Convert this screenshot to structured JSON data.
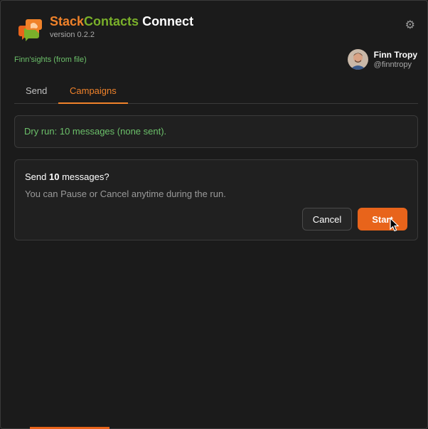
{
  "app": {
    "title_part1": "Stack",
    "title_part2": "Contacts",
    "title_part3": " Connect",
    "version": "version 0.2.2"
  },
  "source_label": "Finn'sights (from file)",
  "user": {
    "name": "Finn Tropy",
    "handle": "@finntropy"
  },
  "tabs": [
    {
      "label": "Send",
      "active": false
    },
    {
      "label": "Campaigns",
      "active": true
    }
  ],
  "dry_run": {
    "text": "Dry run: 10 messages (none sent)."
  },
  "confirm": {
    "title_prefix": "Send ",
    "count": "10",
    "title_suffix": " messages?",
    "subtitle": "You can Pause or Cancel anytime during the run.",
    "cancel_label": "Cancel",
    "start_label": "Start"
  },
  "colors": {
    "accent_orange": "#f0822a",
    "accent_green": "#7ab02a",
    "success_text": "#6cc06a",
    "primary_button": "#e8641b"
  },
  "icons": {
    "logo": "chat-bubbles-logo",
    "settings": "gear-icon",
    "pointer": "mouse-pointer-icon"
  }
}
